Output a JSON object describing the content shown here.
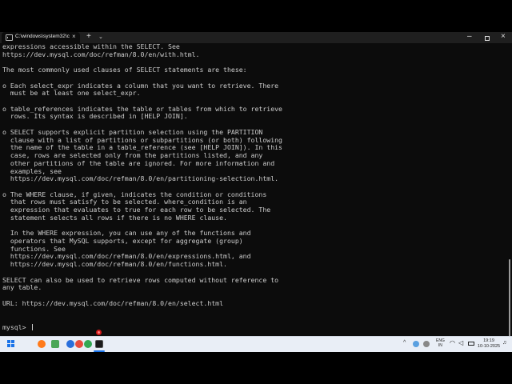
{
  "window": {
    "tab_title": "C:\\windows\\system32\\cmd.ex",
    "tab_close": "×",
    "new_tab": "+",
    "dropdown": "⌄",
    "min": "–",
    "close": "×"
  },
  "terminal": {
    "lines": [
      "expressions accessible within the SELECT. See",
      "https://dev.mysql.com/doc/refman/8.0/en/with.html.",
      "",
      "The most commonly used clauses of SELECT statements are these:",
      "",
      "o Each select_expr indicates a column that you want to retrieve. There",
      "  must be at least one select_expr.",
      "",
      "o table_references indicates the table or tables from which to retrieve",
      "  rows. Its syntax is described in [HELP JOIN].",
      "",
      "o SELECT supports explicit partition selection using the PARTITION",
      "  clause with a list of partitions or subpartitions (or both) following",
      "  the name of the table in a table_reference (see [HELP JOIN]). In this",
      "  case, rows are selected only from the partitions listed, and any",
      "  other partitions of the table are ignored. For more information and",
      "  examples, see",
      "  https://dev.mysql.com/doc/refman/8.0/en/partitioning-selection.html.",
      "",
      "o The WHERE clause, if given, indicates the condition or conditions",
      "  that rows must satisfy to be selected. where_condition is an",
      "  expression that evaluates to true for each row to be selected. The",
      "  statement selects all rows if there is no WHERE clause.",
      "",
      "  In the WHERE expression, you can use any of the functions and",
      "  operators that MySQL supports, except for aggregate (group)",
      "  functions. See",
      "  https://dev.mysql.com/doc/refman/8.0/en/expressions.html, and",
      "  https://dev.mysql.com/doc/refman/8.0/en/functions.html.",
      "",
      "SELECT can also be used to retrieve rows computed without reference to",
      "any table.",
      "",
      "URL: https://dev.mysql.com/doc/refman/8.0/en/select.html",
      "",
      ""
    ],
    "prompt": "mysql> "
  },
  "taskbar": {
    "tray_up": "^",
    "lang_line1": "ENG",
    "lang_line2": "IN",
    "time": "19:19",
    "date": "10-10-2025"
  },
  "icons": {
    "start": "start-icon",
    "search": "search-icon",
    "file-explorer": "folder-icon",
    "firefox": "firefox-icon",
    "edge": "edge-icon",
    "store": "store-icon",
    "chrome": "chrome-icon",
    "terminal": "terminal-icon"
  }
}
